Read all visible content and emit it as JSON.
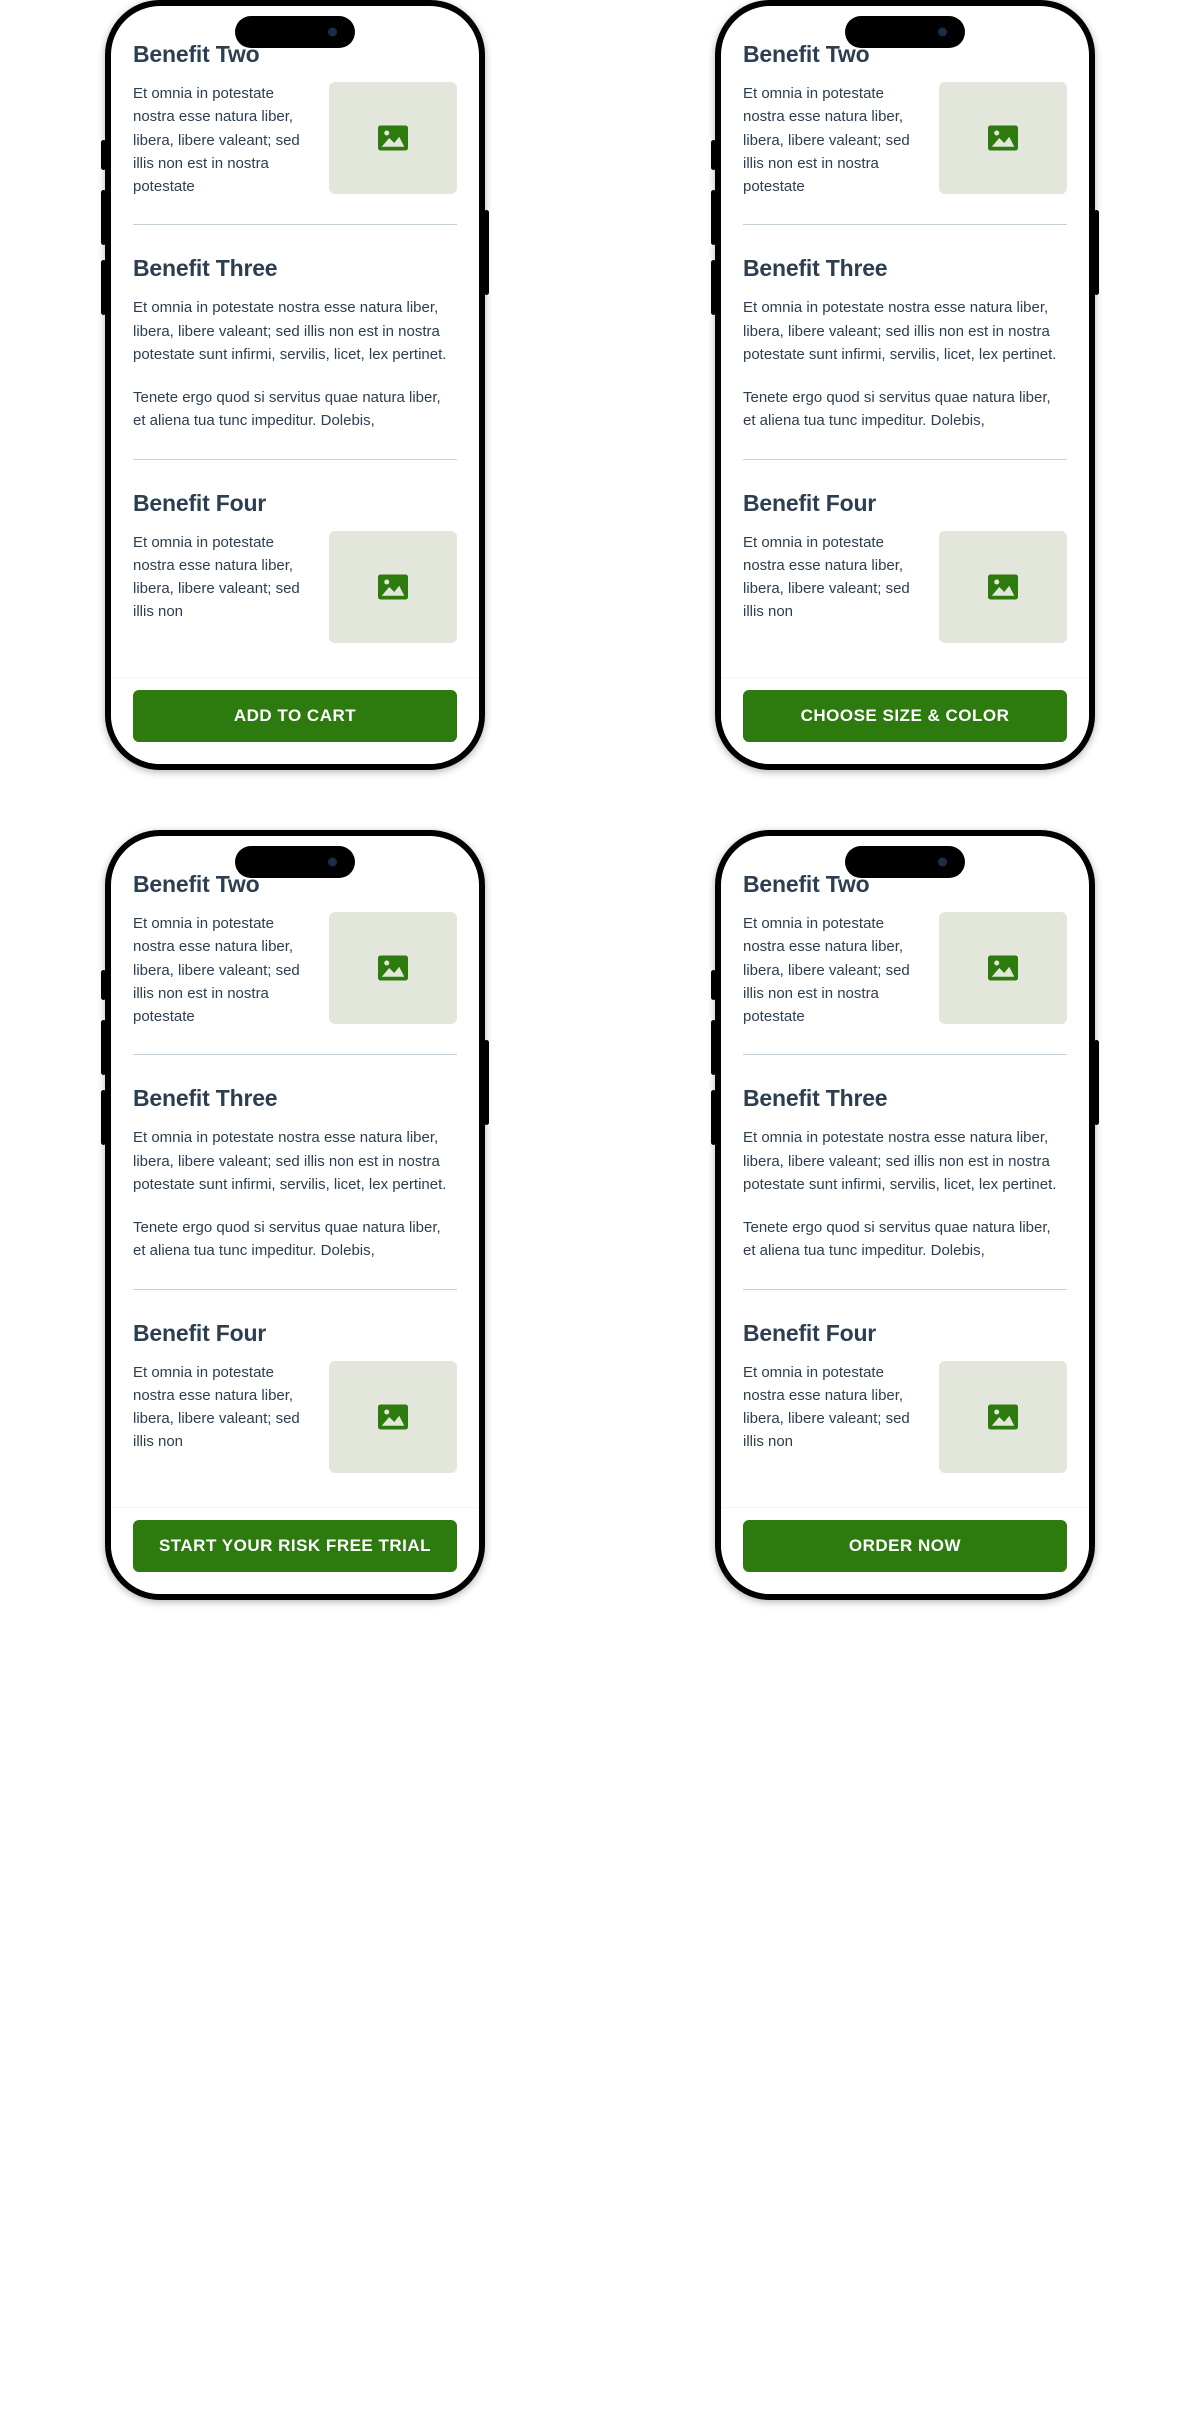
{
  "colors": {
    "accent": "#2d7a0f",
    "heading": "#2c3e50",
    "placeholder_bg": "#e3e7db",
    "divider": "#c5d0d8"
  },
  "benefit_two": {
    "title": "Benefit Two",
    "text": "Et omnia in potestate nostra esse natura liber, libera, libere valeant; sed illis non est in nostra potestate"
  },
  "benefit_three": {
    "title": "Benefit Three",
    "p1": "Et omnia in potestate nostra esse natura liber, libera, libere valeant; sed illis non est in nostra potestate sunt infirmi, servilis, licet, lex pertinet.",
    "p2": "Tenete ergo quod si servitus quae natura liber, et aliena tua tunc impeditur. Dolebis,"
  },
  "benefit_four": {
    "title": "Benefit Four",
    "text": "Et omnia in potestate nostra esse natura liber, libera, libere valeant; sed illis non"
  },
  "phones": [
    {
      "cta_label": "ADD TO CART"
    },
    {
      "cta_label": "CHOOSE SIZE & COLOR"
    },
    {
      "cta_label": "START YOUR RISK FREE TRIAL"
    },
    {
      "cta_label": "ORDER NOW"
    }
  ]
}
